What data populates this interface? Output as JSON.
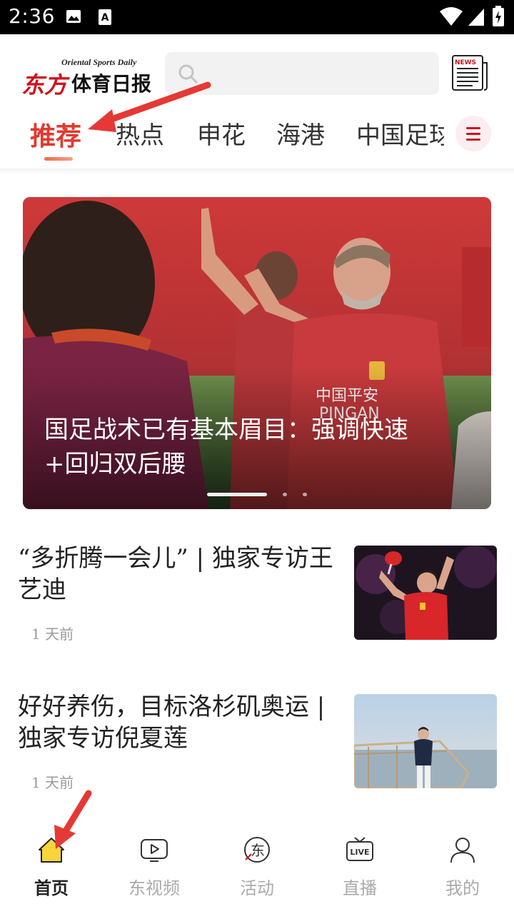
{
  "status_bar": {
    "time": "2:36",
    "icons": [
      "image-icon",
      "a-icon",
      "wifi-icon",
      "signal-icon",
      "battery-icon"
    ]
  },
  "header": {
    "logo_en": "Oriental Sports Daily",
    "logo_cn_red": "东方",
    "logo_cn": "体育日报",
    "search_icon": "search-icon",
    "news_icon_label": "NEWS"
  },
  "tabs": [
    {
      "label": "推荐",
      "active": true
    },
    {
      "label": "热点",
      "active": false
    },
    {
      "label": "申花",
      "active": false
    },
    {
      "label": "海港",
      "active": false
    },
    {
      "label": "中国足球",
      "active": false
    }
  ],
  "hero": {
    "title": "国足战术已有基本眉目：强调快速+回归双后腰",
    "slides_total": 3,
    "slide_active": 1
  },
  "articles": [
    {
      "title": "“多折腾一会儿” | 独家专访王艺迪",
      "time": "1 天前"
    },
    {
      "title": "好好养伤，目标洛杉矶奥运 | 独家专访倪夏莲",
      "time": "1 天前"
    }
  ],
  "bottom_nav": [
    {
      "label": "首页",
      "icon": "home-icon",
      "active": true
    },
    {
      "label": "东视频",
      "icon": "video-play-icon",
      "active": false
    },
    {
      "label": "活动",
      "icon": "event-icon",
      "active": false
    },
    {
      "label": "直播",
      "icon": "live-tv-icon",
      "active": false
    },
    {
      "label": "我的",
      "icon": "profile-icon",
      "active": false
    }
  ],
  "colors": {
    "accent": "#e2392e",
    "brand_red": "#d0121b",
    "home_icon": "#f5d53b",
    "annotation_arrow": "#e53935"
  }
}
